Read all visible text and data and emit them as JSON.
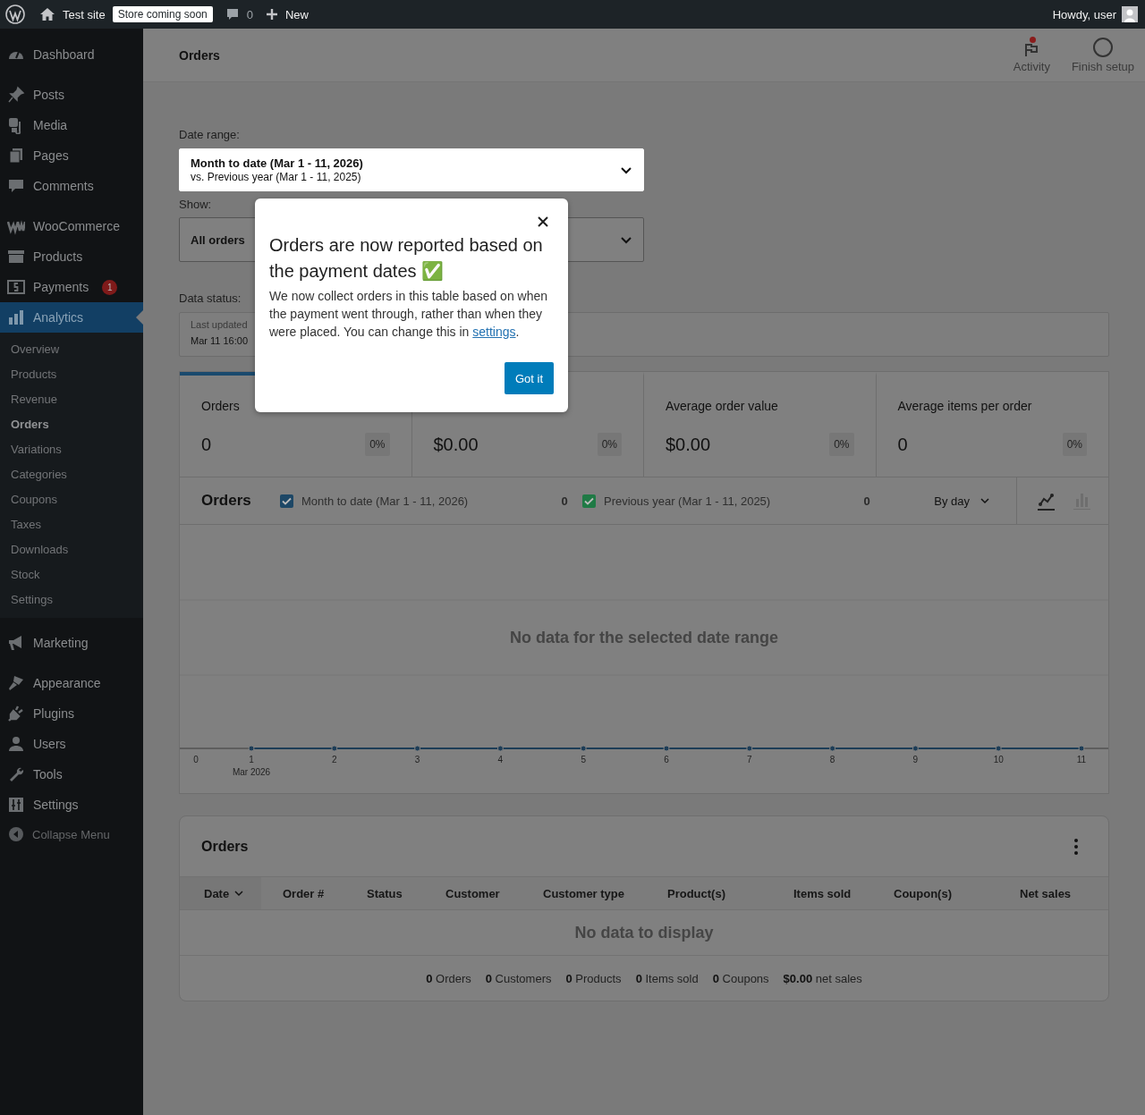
{
  "admin_bar": {
    "site": "Test site",
    "badge": "Store coming soon",
    "comments": "0",
    "new": "New",
    "greeting": "Howdy, user"
  },
  "sidebar": {
    "groups": [
      [
        {
          "label": "Dashboard",
          "selected": false
        }
      ],
      [
        {
          "label": "Posts",
          "selected": false
        },
        {
          "label": "Media",
          "selected": false
        },
        {
          "label": "Pages",
          "selected": false
        },
        {
          "label": "Comments",
          "selected": false
        }
      ],
      [
        {
          "label": "WooCommerce",
          "selected": false
        },
        {
          "label": "Products",
          "selected": false
        },
        {
          "label": "Payments",
          "selected": false,
          "badge": "1"
        },
        {
          "label": "Analytics",
          "selected": true,
          "children": [
            {
              "label": "Overview",
              "selected": false
            },
            {
              "label": "Products",
              "selected": false
            },
            {
              "label": "Revenue",
              "selected": false
            },
            {
              "label": "Orders",
              "selected": true
            },
            {
              "label": "Variations",
              "selected": false
            },
            {
              "label": "Categories",
              "selected": false
            },
            {
              "label": "Coupons",
              "selected": false
            },
            {
              "label": "Taxes",
              "selected": false
            },
            {
              "label": "Downloads",
              "selected": false
            },
            {
              "label": "Stock",
              "selected": false
            },
            {
              "label": "Settings",
              "selected": false
            }
          ]
        }
      ],
      [
        {
          "label": "Marketing",
          "selected": false
        }
      ],
      [
        {
          "label": "Appearance",
          "selected": false
        },
        {
          "label": "Plugins",
          "selected": false
        },
        {
          "label": "Users",
          "selected": false
        },
        {
          "label": "Tools",
          "selected": false
        },
        {
          "label": "Settings",
          "selected": false
        }
      ]
    ],
    "collapse": "Collapse Menu"
  },
  "header": {
    "title": "Orders",
    "actions": [
      {
        "label": "Activity",
        "unread": true
      },
      {
        "label": "Finish setup",
        "unread": false
      }
    ]
  },
  "filters": {
    "date_range": {
      "label": "Date range:",
      "value": "Month to date (Mar 1 - 11, 2026)",
      "compare": "vs. Previous year (Mar 1 - 11, 2025)"
    },
    "show": {
      "label": "Show:",
      "value": "All orders"
    },
    "data_status": {
      "label": "Data status:",
      "caption": "Last updated",
      "value": "Mar 11 16:00"
    }
  },
  "summary": [
    {
      "label": "Orders",
      "value": "0",
      "delta": "0%",
      "selected": true
    },
    {
      "value": "$0.00",
      "delta": "0%",
      "selected": false
    },
    {
      "label": "Average order value",
      "value": "$0.00",
      "delta": "0%",
      "selected": false
    },
    {
      "label": "Average items per order",
      "value": "0",
      "delta": "0%",
      "selected": false
    }
  ],
  "chart": {
    "title": "Orders",
    "legend": [
      {
        "label": "Month to date (Mar 1 - 11, 2026)",
        "total": "0",
        "checked": true,
        "color": "#1d4766"
      },
      {
        "label": "Previous year (Mar 1 - 11, 2025)",
        "total": "0",
        "checked": true,
        "color": "#1f7a45"
      }
    ],
    "interval": "By day",
    "views": [
      {
        "selected": true
      },
      {
        "selected": false
      }
    ],
    "empty": "No data for the selected date range",
    "x_labels": [
      "0",
      "1",
      "2",
      "3",
      "4",
      "5",
      "6",
      "7",
      "8",
      "9",
      "10",
      "11"
    ],
    "x_sublabel": "Mar 2026"
  },
  "table": {
    "title": "Orders",
    "columns": [
      {
        "label": "Date",
        "sorted": true
      },
      {
        "label": "Order #",
        "sorted": false
      },
      {
        "label": "Status",
        "sorted": false
      },
      {
        "label": "Customer",
        "sorted": false
      },
      {
        "label": "Customer type",
        "sorted": false
      },
      {
        "label": "Product(s)",
        "sorted": false
      },
      {
        "label": "Items sold",
        "sorted": false
      },
      {
        "label": "Coupon(s)",
        "sorted": false
      },
      {
        "label": "Net sales",
        "sorted": false
      }
    ],
    "empty": "No data to display",
    "totals": [
      "**0** Orders",
      "**0** Customers",
      "**0** Products",
      "**0** Items sold",
      "**0** Coupons",
      "**$0.00** net sales"
    ]
  },
  "popover": {
    "title": "Orders are now reported based on the payment dates ✅",
    "body": "We now collect orders in this table based on when the payment went through, rather than when they were placed. You can change this in ",
    "link": "settings",
    "body_end": ".",
    "button": "Got it"
  }
}
